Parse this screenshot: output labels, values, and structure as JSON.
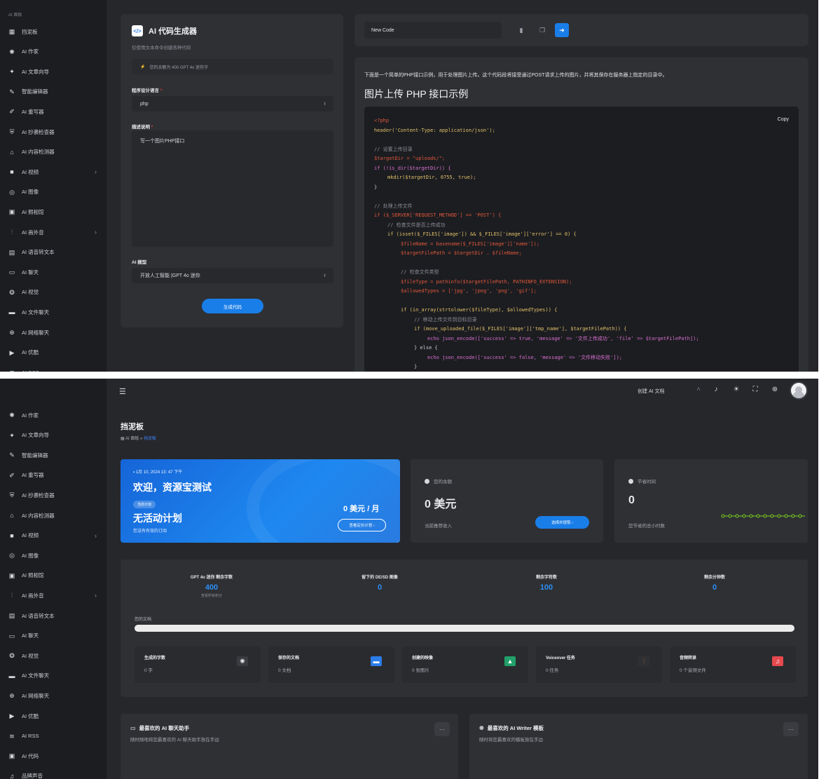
{
  "sidebar_top": {
    "section_label": "AI 面板",
    "items": [
      {
        "icon": "grid-icon",
        "glyph": "▦",
        "label": "挡泥板",
        "chev": false
      },
      {
        "icon": "chip-icon",
        "glyph": "✺",
        "label": "AI 作家",
        "chev": false
      },
      {
        "icon": "sparkle-icon",
        "glyph": "✦",
        "label": "AI 文章向导",
        "chev": false
      },
      {
        "icon": "brush-icon",
        "glyph": "✎",
        "label": "智能编辑器",
        "chev": false
      },
      {
        "icon": "pen-icon",
        "glyph": "✐",
        "label": "AI 重写器",
        "chev": false
      },
      {
        "icon": "shield-icon",
        "glyph": "⛨",
        "label": "AI 抄袭检查器",
        "chev": false
      },
      {
        "icon": "bank-icon",
        "glyph": "⌂",
        "label": "AI 内容检测器",
        "chev": false
      },
      {
        "icon": "video-icon",
        "glyph": "■",
        "label": "AI 视频",
        "chev": true
      },
      {
        "icon": "scan-icon",
        "glyph": "◎",
        "label": "AI 图像",
        "chev": false
      },
      {
        "icon": "photo-icon",
        "glyph": "▣",
        "label": "AI 照相馆",
        "chev": false
      },
      {
        "icon": "waveform-icon",
        "glyph": "⫶",
        "label": "AI 画外音",
        "chev": true
      },
      {
        "icon": "speech-text-icon",
        "glyph": "▤",
        "label": "AI 语音转文本",
        "chev": false
      },
      {
        "icon": "chat-icon",
        "glyph": "▭",
        "label": "AI 聊天",
        "chev": false
      },
      {
        "icon": "vision-icon",
        "glyph": "❂",
        "label": "AI 视觉",
        "chev": false
      },
      {
        "icon": "folder-chat-icon",
        "glyph": "▬",
        "label": "AI 文件聊天",
        "chev": false
      },
      {
        "icon": "globe-icon",
        "glyph": "⊕",
        "label": "AI 网络聊天",
        "chev": false
      },
      {
        "icon": "youtube-icon",
        "glyph": "▶",
        "label": "AI 优酷",
        "chev": false
      },
      {
        "icon": "rss-icon",
        "glyph": "≋",
        "label": "AI RSS",
        "chev": false
      }
    ]
  },
  "generator": {
    "title": "AI 代码生成器",
    "subtitle": "仅使用文本命令创建各种代码",
    "notice": "您的余额为 400 GPT 4o 迷你字",
    "lang_label": "程序设计语言",
    "lang_value": "php",
    "desc_label": "描述说明",
    "desc_value": "写一个图片PHP接口",
    "model_label": "AI 模型",
    "model_value": "开放人工智能 |GPT 4o 迷你",
    "generate_btn": "生成代码"
  },
  "editor": {
    "code_name": "New Code",
    "intro": "下面是一个简单的PHP接口示例，用于处理图片上传。这个代码段将接受通过POST请求上传的图片，并将其保存在服务器上指定的目录中。",
    "heading": "图片上传 PHP 接口示例",
    "copy_label": "Copy",
    "code_lines": [
      {
        "text": "<?php",
        "color": "#e0583b",
        "indent": 0
      },
      {
        "text": "header('Content-Type: application/json');",
        "color": "#e0c068",
        "indent": 0
      },
      {
        "text": "",
        "color": "#c9ccd3",
        "indent": 0
      },
      {
        "text": "// 设置上传目录",
        "color": "#8a8d95",
        "indent": 0
      },
      {
        "text": "$targetDir = \"uploads/\";",
        "color": "#e0583b",
        "indent": 0
      },
      {
        "text": "if (!is_dir($targetDir)) {",
        "color": "#d86fd0",
        "indent": 0
      },
      {
        "text": "mkdir($targetDir, 0755, true);",
        "color": "#e0c068",
        "indent": 1
      },
      {
        "text": "}",
        "color": "#c9ccd3",
        "indent": 0
      },
      {
        "text": "",
        "color": "#c9ccd3",
        "indent": 0
      },
      {
        "text": "// 处理上传文件",
        "color": "#8a8d95",
        "indent": 0
      },
      {
        "text": "if ($_SERVER['REQUEST_METHOD'] == 'POST') {",
        "color": "#e0583b",
        "indent": 0
      },
      {
        "text": "// 检查文件是否上传成功",
        "color": "#8a8d95",
        "indent": 1
      },
      {
        "text": "if (isset($_FILES['image']) && $_FILES['image']['error'] == 0) {",
        "color": "#e0c068",
        "indent": 1
      },
      {
        "text": "$fileName = basename($_FILES['image']['name']);",
        "color": "#e0583b",
        "indent": 2
      },
      {
        "text": "$targetFilePath = $targetDir . $fileName;",
        "color": "#e0583b",
        "indent": 2
      },
      {
        "text": "",
        "color": "#c9ccd3",
        "indent": 0
      },
      {
        "text": "// 检查文件类型",
        "color": "#8a8d95",
        "indent": 2
      },
      {
        "text": "$fileType = pathinfo($targetFilePath, PATHINFO_EXTENSION);",
        "color": "#e0583b",
        "indent": 2
      },
      {
        "text": "$allowedTypes = ['jpg', 'jpeg', 'png', 'gif'];",
        "color": "#e0583b",
        "indent": 2
      },
      {
        "text": "",
        "color": "#c9ccd3",
        "indent": 0
      },
      {
        "text": "if (in_array(strtolower($fileType), $allowedTypes)) {",
        "color": "#e0c068",
        "indent": 2
      },
      {
        "text": "// 移动上传文件到目标目录",
        "color": "#8a8d95",
        "indent": 3
      },
      {
        "text": "if (move_uploaded_file($_FILES['image']['tmp_name'], $targetFilePath)) {",
        "color": "#e0c068",
        "indent": 3
      },
      {
        "text": "echo json_encode(['success' => true, 'message' => '文件上传成功', 'file' => $targetFilePath]);",
        "color": "#d86fd0",
        "indent": 4
      },
      {
        "text": "} else {",
        "color": "#c9ccd3",
        "indent": 3
      },
      {
        "text": "echo json_encode(['success' => false, 'message' => '文件移动失败']);",
        "color": "#d86fd0",
        "indent": 4
      },
      {
        "text": "}",
        "color": "#c9ccd3",
        "indent": 3
      }
    ]
  },
  "sidebar_bottom": {
    "items": [
      {
        "icon": "chip-icon",
        "glyph": "✺",
        "label": "AI 作家",
        "chev": false
      },
      {
        "icon": "sparkle-icon",
        "glyph": "✦",
        "label": "AI 文章向导",
        "chev": false
      },
      {
        "icon": "brush-icon",
        "glyph": "✎",
        "label": "智能编辑器",
        "chev": false
      },
      {
        "icon": "pen-icon",
        "glyph": "✐",
        "label": "AI 重写器",
        "chev": false
      },
      {
        "icon": "shield-icon",
        "glyph": "⛨",
        "label": "AI 抄袭检查器",
        "chev": false
      },
      {
        "icon": "bank-icon",
        "glyph": "⌂",
        "label": "AI 内容检测器",
        "chev": false
      },
      {
        "icon": "video-icon",
        "glyph": "■",
        "label": "AI 视频",
        "chev": true
      },
      {
        "icon": "scan-icon",
        "glyph": "◎",
        "label": "AI 图像",
        "chev": false
      },
      {
        "icon": "photo-icon",
        "glyph": "▣",
        "label": "AI 照相馆",
        "chev": false
      },
      {
        "icon": "waveform-icon",
        "glyph": "⫶",
        "label": "AI 画外音",
        "chev": true
      },
      {
        "icon": "speech-text-icon",
        "glyph": "▤",
        "label": "AI 语音转文本",
        "chev": false
      },
      {
        "icon": "chat-icon",
        "glyph": "▭",
        "label": "AI 聊天",
        "chev": false
      },
      {
        "icon": "vision-icon",
        "glyph": "❂",
        "label": "AI 视觉",
        "chev": false
      },
      {
        "icon": "folder-chat-icon",
        "glyph": "▬",
        "label": "AI 文件聊天",
        "chev": false
      },
      {
        "icon": "globe-icon",
        "glyph": "⊕",
        "label": "AI 网络聊天",
        "chev": false
      },
      {
        "icon": "youtube-icon",
        "glyph": "▶",
        "label": "AI 优酷",
        "chev": false
      },
      {
        "icon": "rss-icon",
        "glyph": "≋",
        "label": "AI RSS",
        "chev": false
      },
      {
        "icon": "code-icon",
        "glyph": "▣",
        "label": "AI 代码",
        "chev": false
      },
      {
        "icon": "voice-icon",
        "glyph": "♫",
        "label": "品牌声音",
        "chev": false
      }
    ]
  },
  "topbar": {
    "create_doc": "创建 AI 文档"
  },
  "dashboard": {
    "title": "挡泥板",
    "crumb_root": "AI 面板",
    "crumb_sep": "»",
    "crumb_current": "挡泥板",
    "welcome": {
      "date": "1月 10, 2024 13: 47 下午",
      "greeting": "欢迎，资源宝测试",
      "badge": "当前计划",
      "plan": "无活动计划",
      "plan_sub": "您没有有效的订阅",
      "price": "0 美元 / 月",
      "btn": "查看定价计划 ›"
    },
    "balance": {
      "label": "您的余额",
      "value": "0 美元",
      "sub": "当前推荐收入",
      "btn": "选择并提取 ›"
    },
    "saved_time": {
      "label": "节省时间",
      "value": "0",
      "sub": "您节省的总小时数"
    },
    "metrics": [
      {
        "label": "GPT 4o 迷你 剩余字数",
        "value": "400",
        "sub": "查看所有积分"
      },
      {
        "label": "留下的 DE/SD 图像",
        "value": "0",
        "sub": ""
      },
      {
        "label": "剩余字符数",
        "value": "100",
        "sub": ""
      },
      {
        "label": "剩余分钟数",
        "value": "0",
        "sub": ""
      }
    ],
    "doc_label": "您的文档",
    "minis": [
      {
        "label": "生成的字数",
        "sub": "0 字",
        "icon": "chip-icon",
        "glyph": "✺",
        "color": "#3a3b40",
        "fg": "#e6e7ea"
      },
      {
        "label": "保存的文档",
        "sub": "0 文档",
        "icon": "folder-icon",
        "glyph": "▬",
        "color": "#2b7de9",
        "fg": "#ffffff"
      },
      {
        "label": "创建的映像",
        "sub": "0 张图片",
        "icon": "image-icon",
        "glyph": "▲",
        "color": "#22a06b",
        "fg": "#ffffff"
      },
      {
        "label": "Voiceover 任务",
        "sub": "0 任务",
        "icon": "waveform-icon",
        "glyph": "⫶",
        "color": "#2f3034",
        "fg": "#f5a623"
      },
      {
        "label": "音频转录",
        "sub": "0 个音频文件",
        "icon": "music-file-icon",
        "glyph": "♫",
        "color": "#e5484d",
        "fg": "#ffffff"
      }
    ],
    "fav_chat": {
      "title": "最喜欢的 AI 聊天助手",
      "sub": "随时随地将您最喜欢的 AI 聊天助手放在手边",
      "more": "···"
    },
    "fav_writer": {
      "title": "最喜欢的 AI Writer 模板",
      "sub": "随时将您最喜欢的模板放在手边",
      "more": "···"
    }
  }
}
